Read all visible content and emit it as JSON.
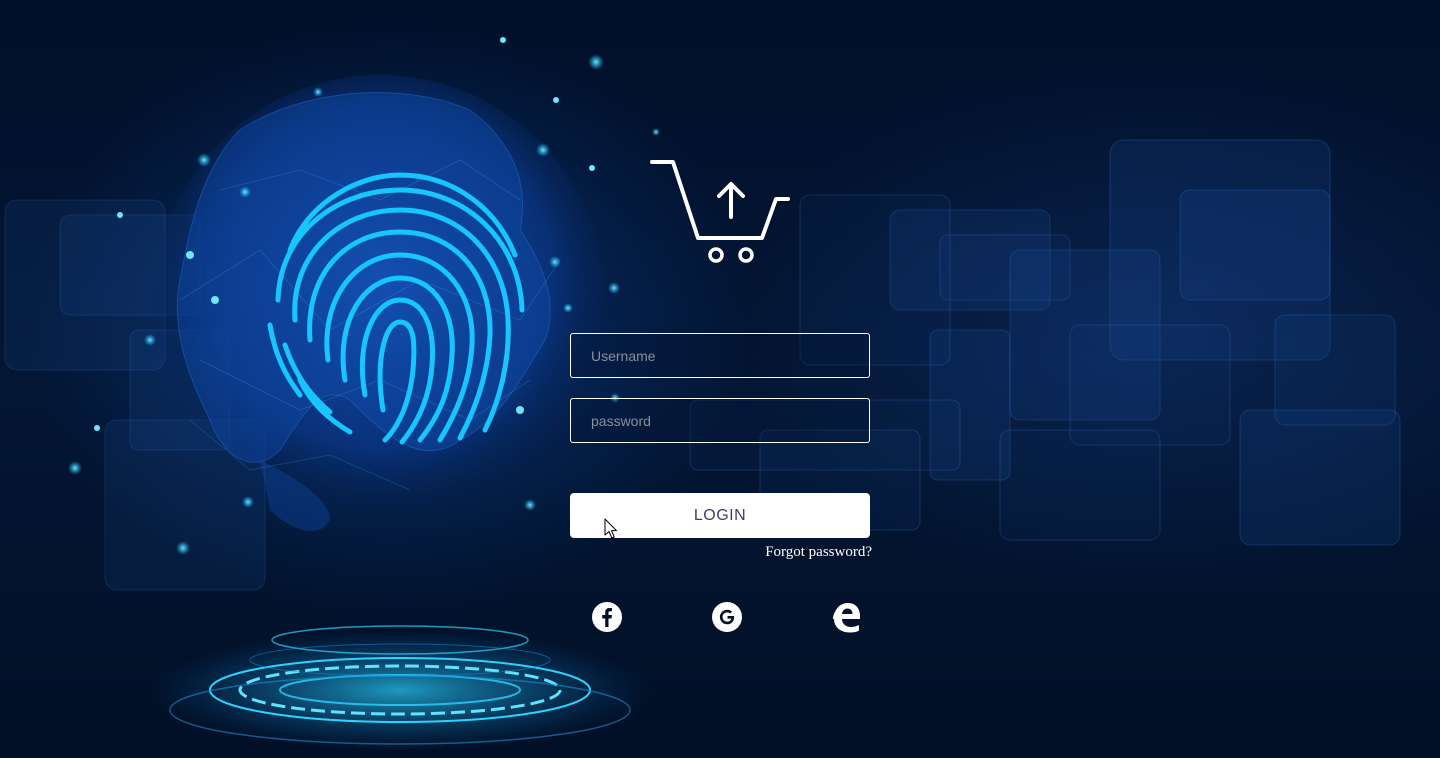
{
  "login_form": {
    "username_placeholder": "Username",
    "password_placeholder": "password",
    "login_label": "LOGIN",
    "forgot_password_label": "Forgot password?"
  },
  "social_login": [
    {
      "name": "facebook",
      "icon": "facebook-icon"
    },
    {
      "name": "google",
      "icon": "google-icon"
    },
    {
      "name": "edge",
      "icon": "edge-icon"
    }
  ],
  "logo": {
    "icon": "shopping-cart-upload-icon"
  },
  "colors": {
    "background": "#02112a",
    "accent": "#0fc4ff",
    "button_text": "#4a3a6a",
    "field_border": "#ffffff"
  }
}
